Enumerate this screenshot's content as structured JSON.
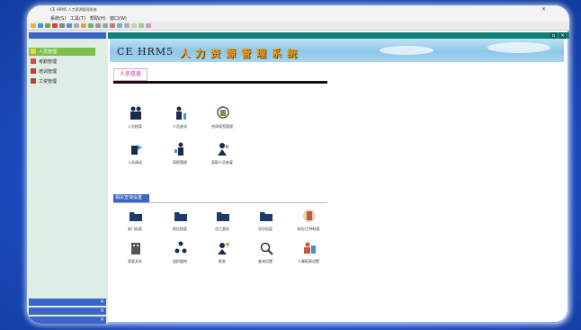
{
  "window": {
    "title": "CE HRM5 人力资源管理系统",
    "close": "×"
  },
  "menu": {
    "items": [
      "系统(S)",
      "工具(T)",
      "帮助(H)",
      "窗口(W)"
    ]
  },
  "sidebar": {
    "items": [
      {
        "label": "人员管理",
        "active": true
      },
      {
        "label": "考勤管理",
        "active": false
      },
      {
        "label": "培训管理",
        "active": false
      },
      {
        "label": "工资管理",
        "active": false
      }
    ]
  },
  "banner": {
    "brand": "CE HRM5",
    "system": "人力资源管理系统"
  },
  "content": {
    "section1_title": "人员信息",
    "section2_title": "相关查询设置",
    "tiles_row1": [
      "人员档案",
      "人员变动",
      "合同续签管理"
    ],
    "tiles_row2": [
      "人员调动",
      "离职管理",
      "离职人员恢复"
    ],
    "tiles_row3": [
      "部门档案",
      "职位档案",
      "员工类别",
      "学历档案",
      "岗位/工种档案"
    ],
    "tiles_row4": [
      "家庭关系",
      "组织架构",
      "职务",
      "查询设置",
      "人事报表设置"
    ]
  },
  "colors": {
    "teal": "#0f7f78",
    "sidebar_blue": "#3b64c8",
    "active_green": "#7ac04a",
    "tab_pink": "#c0179a"
  }
}
